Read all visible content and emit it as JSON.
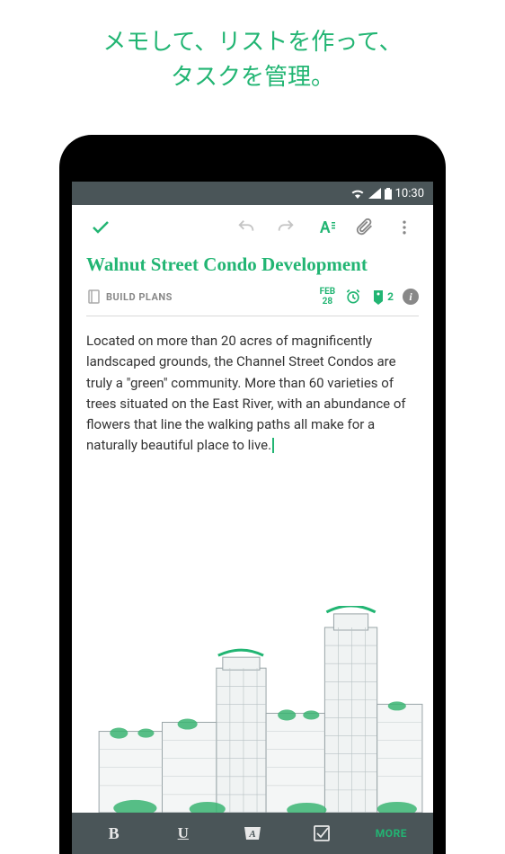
{
  "promo": {
    "line1": "メモして、リストを作って、",
    "line2": "タスクを管理。"
  },
  "status": {
    "time": "10:30"
  },
  "note": {
    "title": "Walnut Street Condo Development",
    "notebook": "BUILD PLANS",
    "date_month": "FEB",
    "date_day": "28",
    "tag_count": "2",
    "body": "Located on more than 20 acres of magnificently landscaped grounds, the Channel Street Condos are truly a \"green\" community. More than 60 varieties of trees situated on the East River, with an abundance of flowers that line the walking paths all make for a naturally beautiful place to live."
  },
  "bottom": {
    "more": "MORE"
  },
  "colors": {
    "accent": "#22b573",
    "toolbar_bg": "#4a5558"
  }
}
